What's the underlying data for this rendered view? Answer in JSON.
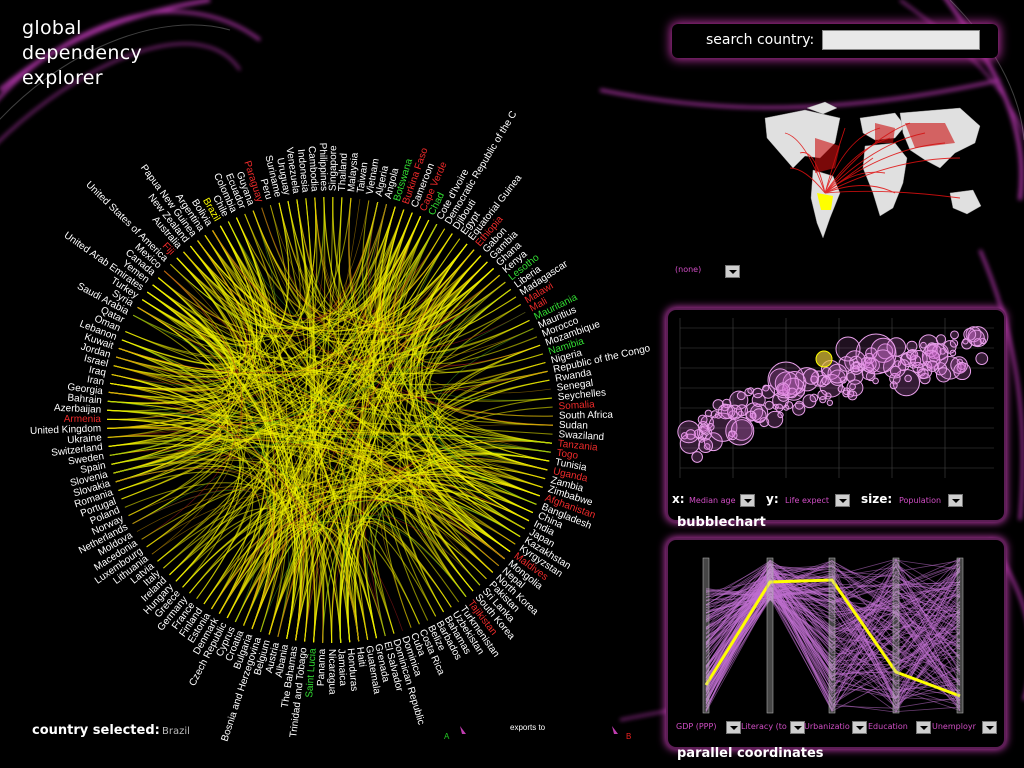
{
  "app": {
    "title_lines": [
      "global",
      "dependency",
      "explorer"
    ]
  },
  "search": {
    "label": "search country:",
    "value": ""
  },
  "map": {
    "selector_value": "(none)"
  },
  "bubble": {
    "title": "bubblechart",
    "x_label": "x:",
    "x_value": "Median age",
    "y_label": "y:",
    "y_value": "Life expect",
    "size_label": "size:",
    "size_value": "Population"
  },
  "parallel": {
    "title": "parallel coordinates",
    "axes": [
      "GDP (PPP)",
      "Literacy (to",
      "Urbanizatio",
      "Education",
      "Unemployr"
    ]
  },
  "selection": {
    "label": "country selected:",
    "value": "Brazil"
  },
  "legend": {
    "text": "exports to",
    "left_mark": "A",
    "right_mark": "B"
  },
  "colors": {
    "accent": "#c03cb0",
    "selected": "#ffff00",
    "chord": "#f2f200",
    "positive": "#22cc22",
    "negative": "#ee2222"
  },
  "countries": [
    {
      "name": "Venezuela",
      "c": "w"
    },
    {
      "name": "Indonesia",
      "c": "w"
    },
    {
      "name": "Cambodia",
      "c": "w"
    },
    {
      "name": "Philippines",
      "c": "w"
    },
    {
      "name": "Singapore",
      "c": "w"
    },
    {
      "name": "Thailand",
      "c": "w"
    },
    {
      "name": "Malaysia",
      "c": "w"
    },
    {
      "name": "Taiwan",
      "c": "w"
    },
    {
      "name": "Vietnam",
      "c": "w"
    },
    {
      "name": "Algeria",
      "c": "w"
    },
    {
      "name": "Angola",
      "c": "w"
    },
    {
      "name": "Botswana",
      "c": "g"
    },
    {
      "name": "Burkina Faso",
      "c": "r"
    },
    {
      "name": "Cameroon",
      "c": "w"
    },
    {
      "name": "Cape Verde",
      "c": "r"
    },
    {
      "name": "Chad",
      "c": "g"
    },
    {
      "name": "Cote d'Ivoire",
      "c": "w"
    },
    {
      "name": "Democratic Republic of the C",
      "c": "w"
    },
    {
      "name": "Djibouti",
      "c": "w"
    },
    {
      "name": "Egypt",
      "c": "w"
    },
    {
      "name": "Equatorial Guinea",
      "c": "w"
    },
    {
      "name": "Ethiopia",
      "c": "r"
    },
    {
      "name": "Gabon",
      "c": "w"
    },
    {
      "name": "Gambia",
      "c": "w"
    },
    {
      "name": "Ghana",
      "c": "w"
    },
    {
      "name": "Kenya",
      "c": "w"
    },
    {
      "name": "Lesotho",
      "c": "g"
    },
    {
      "name": "Liberia",
      "c": "w"
    },
    {
      "name": "Madagascar",
      "c": "w"
    },
    {
      "name": "Malawi",
      "c": "r"
    },
    {
      "name": "Mali",
      "c": "r"
    },
    {
      "name": "Mauritania",
      "c": "g"
    },
    {
      "name": "Mauritius",
      "c": "w"
    },
    {
      "name": "Morocco",
      "c": "w"
    },
    {
      "name": "Mozambique",
      "c": "w"
    },
    {
      "name": "Namibia",
      "c": "g"
    },
    {
      "name": "Nigeria",
      "c": "w"
    },
    {
      "name": "Republic of the Congo",
      "c": "w"
    },
    {
      "name": "Rwanda",
      "c": "w"
    },
    {
      "name": "Senegal",
      "c": "w"
    },
    {
      "name": "Seychelles",
      "c": "w"
    },
    {
      "name": "Somalia",
      "c": "r"
    },
    {
      "name": "South Africa",
      "c": "w"
    },
    {
      "name": "Sudan",
      "c": "w"
    },
    {
      "name": "Swaziland",
      "c": "w"
    },
    {
      "name": "Tanzania",
      "c": "r"
    },
    {
      "name": "Togo",
      "c": "r"
    },
    {
      "name": "Tunisia",
      "c": "w"
    },
    {
      "name": "Uganda",
      "c": "r"
    },
    {
      "name": "Zambia",
      "c": "w"
    },
    {
      "name": "Zimbabwe",
      "c": "w"
    },
    {
      "name": "Afghanistan",
      "c": "r"
    },
    {
      "name": "Bangladesh",
      "c": "w"
    },
    {
      "name": "China",
      "c": "w"
    },
    {
      "name": "India",
      "c": "w"
    },
    {
      "name": "Japan",
      "c": "w"
    },
    {
      "name": "Kazakhstan",
      "c": "w"
    },
    {
      "name": "Kyrgyzstan",
      "c": "w"
    },
    {
      "name": "Maldives",
      "c": "r"
    },
    {
      "name": "Mongolia",
      "c": "w"
    },
    {
      "name": "Nepal",
      "c": "w"
    },
    {
      "name": "North Korea",
      "c": "w"
    },
    {
      "name": "Pakistan",
      "c": "w"
    },
    {
      "name": "Sri Lanka",
      "c": "w"
    },
    {
      "name": "South Korea",
      "c": "w"
    },
    {
      "name": "Tajikistan",
      "c": "r"
    },
    {
      "name": "Turkmenistan",
      "c": "w"
    },
    {
      "name": "Uzbekistan",
      "c": "w"
    },
    {
      "name": "Bahamas",
      "c": "w"
    },
    {
      "name": "Barbados",
      "c": "w"
    },
    {
      "name": "Belize",
      "c": "w"
    },
    {
      "name": "Costa Rica",
      "c": "w"
    },
    {
      "name": "Cuba",
      "c": "w"
    },
    {
      "name": "Dominica",
      "c": "w"
    },
    {
      "name": "Dominican Republic",
      "c": "w"
    },
    {
      "name": "El Salvador",
      "c": "w"
    },
    {
      "name": "Grenada",
      "c": "w"
    },
    {
      "name": "Guatemala",
      "c": "w"
    },
    {
      "name": "Haiti",
      "c": "w"
    },
    {
      "name": "Honduras",
      "c": "w"
    },
    {
      "name": "Jamaica",
      "c": "w"
    },
    {
      "name": "Nicaragua",
      "c": "w"
    },
    {
      "name": "Panama",
      "c": "w"
    },
    {
      "name": "Saint Lucia",
      "c": "g"
    },
    {
      "name": "Trinidad and Tobago",
      "c": "w"
    },
    {
      "name": "The Bahamas",
      "c": "w"
    },
    {
      "name": "Albania",
      "c": "w"
    },
    {
      "name": "Austria",
      "c": "w"
    },
    {
      "name": "Belgium",
      "c": "w"
    },
    {
      "name": "Bosnia and Herzegovina",
      "c": "w"
    },
    {
      "name": "Bulgaria",
      "c": "w"
    },
    {
      "name": "Croatia",
      "c": "w"
    },
    {
      "name": "Cyprus",
      "c": "w"
    },
    {
      "name": "Czech Republic",
      "c": "w"
    },
    {
      "name": "Denmark",
      "c": "w"
    },
    {
      "name": "Estonia",
      "c": "w"
    },
    {
      "name": "Finland",
      "c": "w"
    },
    {
      "name": "France",
      "c": "w"
    },
    {
      "name": "Germany",
      "c": "w"
    },
    {
      "name": "Greece",
      "c": "w"
    },
    {
      "name": "Hungary",
      "c": "w"
    },
    {
      "name": "Ireland",
      "c": "w"
    },
    {
      "name": "Italy",
      "c": "w"
    },
    {
      "name": "Latvia",
      "c": "w"
    },
    {
      "name": "Lithuania",
      "c": "w"
    },
    {
      "name": "Luxembourg",
      "c": "w"
    },
    {
      "name": "Macedonia",
      "c": "w"
    },
    {
      "name": "Moldova",
      "c": "w"
    },
    {
      "name": "Netherlands",
      "c": "w"
    },
    {
      "name": "Norway",
      "c": "w"
    },
    {
      "name": "Poland",
      "c": "w"
    },
    {
      "name": "Portugal",
      "c": "w"
    },
    {
      "name": "Romania",
      "c": "w"
    },
    {
      "name": "Slovakia",
      "c": "w"
    },
    {
      "name": "Slovenia",
      "c": "w"
    },
    {
      "name": "Spain",
      "c": "w"
    },
    {
      "name": "Sweden",
      "c": "w"
    },
    {
      "name": "Switzerland",
      "c": "w"
    },
    {
      "name": "Ukraine",
      "c": "w"
    },
    {
      "name": "United Kingdom",
      "c": "w"
    },
    {
      "name": "Armenia",
      "c": "r"
    },
    {
      "name": "Azerbaijan",
      "c": "w"
    },
    {
      "name": "Bahrain",
      "c": "w"
    },
    {
      "name": "Georgia",
      "c": "w"
    },
    {
      "name": "Iran",
      "c": "w"
    },
    {
      "name": "Iraq",
      "c": "w"
    },
    {
      "name": "Israel",
      "c": "w"
    },
    {
      "name": "Jordan",
      "c": "w"
    },
    {
      "name": "Kuwait",
      "c": "w"
    },
    {
      "name": "Lebanon",
      "c": "w"
    },
    {
      "name": "Oman",
      "c": "w"
    },
    {
      "name": "Qatar",
      "c": "w"
    },
    {
      "name": "Saudi Arabia",
      "c": "w"
    },
    {
      "name": "Syria",
      "c": "w"
    },
    {
      "name": "Turkey",
      "c": "w"
    },
    {
      "name": "United Arab Emirates",
      "c": "w"
    },
    {
      "name": "Yemen",
      "c": "w"
    },
    {
      "name": "Canada",
      "c": "w"
    },
    {
      "name": "Mexico",
      "c": "w"
    },
    {
      "name": "United States of America",
      "c": "w"
    },
    {
      "name": "Fiji",
      "c": "r"
    },
    {
      "name": "Australia",
      "c": "w"
    },
    {
      "name": "New Zealand",
      "c": "w"
    },
    {
      "name": "Papua New Guinea",
      "c": "w"
    },
    {
      "name": "Argentina",
      "c": "w"
    },
    {
      "name": "Bolivia",
      "c": "w"
    },
    {
      "name": "Brazil",
      "c": "y"
    },
    {
      "name": "Chile",
      "c": "w"
    },
    {
      "name": "Colombia",
      "c": "w"
    },
    {
      "name": "Ecuador",
      "c": "w"
    },
    {
      "name": "Guyana",
      "c": "w"
    },
    {
      "name": "Paraguay",
      "c": "r"
    },
    {
      "name": "Peru",
      "c": "w"
    },
    {
      "name": "Suriname",
      "c": "w"
    },
    {
      "name": "Uruguay",
      "c": "w"
    }
  ]
}
